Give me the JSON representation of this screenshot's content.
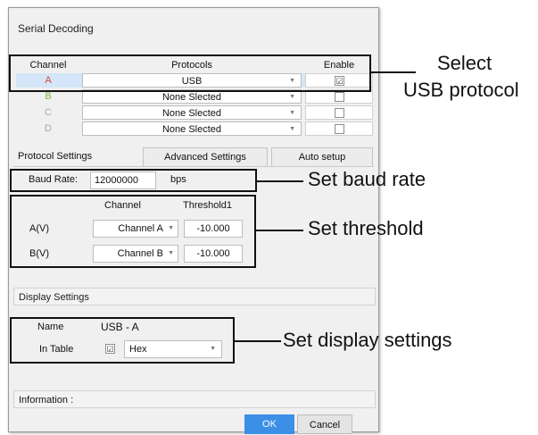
{
  "dialog": {
    "title": "Serial Decoding"
  },
  "table": {
    "headers": {
      "channel": "Channel",
      "protocols": "Protocols",
      "enable": "Enable"
    },
    "rows": [
      {
        "channel": "A",
        "protocol": "USB",
        "enabled": true,
        "color": "#e04040"
      },
      {
        "channel": "B",
        "protocol": "None Slected",
        "enabled": false,
        "color": "#7ab648"
      },
      {
        "channel": "C",
        "protocol": "None Slected",
        "enabled": false,
        "color": "#a8a8a8"
      },
      {
        "channel": "D",
        "protocol": "None Slected",
        "enabled": false,
        "color": "#a8a8a8"
      }
    ],
    "checked_mark": "☑",
    "unchecked_mark": "",
    "dropdown_mark": "▼"
  },
  "tabs": {
    "protocol_settings": "Protocol Settings",
    "advanced_settings": "Advanced Settings",
    "auto_setup": "Auto setup"
  },
  "baud": {
    "label": "Baud Rate:",
    "value": "12000000",
    "unit": "bps"
  },
  "threshold": {
    "channel_header": "Channel",
    "threshold_header": "Threshold1",
    "rows": [
      {
        "label": "A(V)",
        "channel": "Channel A",
        "value": "-10.000"
      },
      {
        "label": "B(V)",
        "channel": "Channel B",
        "value": "-10.000"
      }
    ]
  },
  "display": {
    "header": "Display Settings",
    "name_label": "Name",
    "name_value": "USB - A",
    "in_table_label": "In Table",
    "in_table_checked": "☑",
    "format": "Hex"
  },
  "information": {
    "label": "Information :"
  },
  "buttons": {
    "ok": "OK",
    "cancel": "Cancel"
  },
  "callouts": {
    "select_line1": "Select",
    "select_line2": "USB protocol",
    "baud": "Set baud rate",
    "threshold": "Set threshold",
    "display": "Set display settings"
  },
  "colors": {
    "ok_button": "#3b8fe6",
    "selected_row": "#d4e6f8",
    "accent_text": "#111111"
  }
}
